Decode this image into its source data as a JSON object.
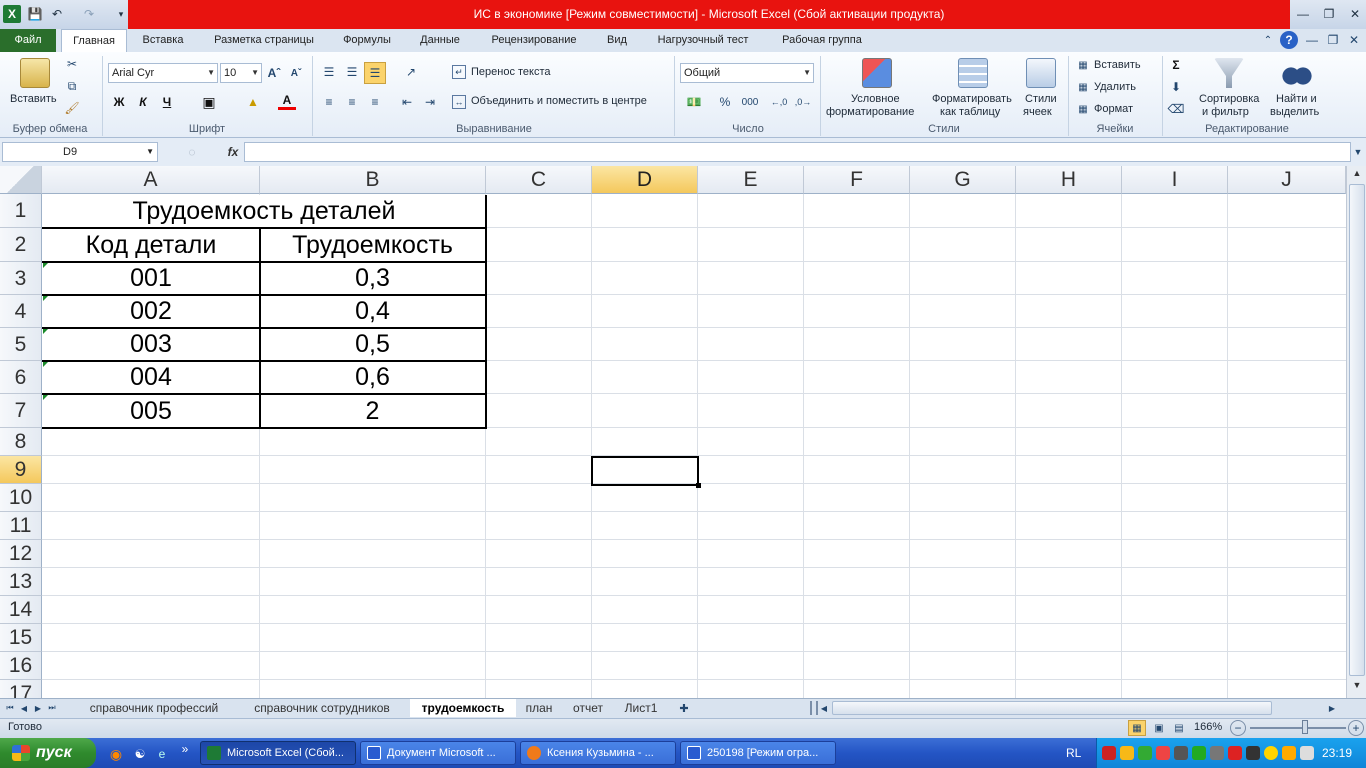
{
  "window": {
    "title": "ИС в экономике  [Режим совместимости]  -  Microsoft Excel (Сбой активации продукта)"
  },
  "ribbon_tabs": [
    "Файл",
    "Главная",
    "Вставка",
    "Разметка страницы",
    "Формулы",
    "Данные",
    "Рецензирование",
    "Вид",
    "Нагрузочный тест",
    "Рабочая группа"
  ],
  "ribbon": {
    "clipboard": {
      "paste": "Вставить",
      "group": "Буфер обмена"
    },
    "font": {
      "name": "Arial Cyr",
      "size": "10",
      "bold": "Ж",
      "italic": "К",
      "underline": "Ч",
      "group": "Шрифт"
    },
    "alignment": {
      "wrap": "Перенос текста",
      "merge": "Объединить и поместить в центре",
      "group": "Выравнивание"
    },
    "number": {
      "format": "Общий",
      "percent": "%",
      "thousands": "000",
      "group": "Число"
    },
    "styles": {
      "conditional1": "Условное",
      "conditional2": "форматирование",
      "astable1": "Форматировать",
      "astable2": "как таблицу",
      "cellstyles1": "Стили",
      "cellstyles2": "ячеек",
      "group": "Стили"
    },
    "cells": {
      "insert": "Вставить",
      "delete": "Удалить",
      "format": "Формат",
      "group": "Ячейки"
    },
    "editing": {
      "sigma": "Σ",
      "sort1": "Сортировка",
      "sort2": "и фильтр",
      "find1": "Найти и",
      "find2": "выделить",
      "group": "Редактирование"
    }
  },
  "formula_bar": {
    "name_box": "D9",
    "fx": "fx",
    "value": ""
  },
  "columns": [
    "A",
    "B",
    "C",
    "D",
    "E",
    "F",
    "G",
    "H",
    "I",
    "J"
  ],
  "rows": [
    "1",
    "2",
    "3",
    "4",
    "5",
    "6",
    "7",
    "8",
    "9",
    "10",
    "11",
    "12",
    "13",
    "14",
    "15",
    "16",
    "17"
  ],
  "sheet": {
    "title": "Трудоемкость деталей",
    "headers": [
      "Код детали",
      "Трудоемкость"
    ],
    "data": [
      [
        "001",
        "0,3"
      ],
      [
        "002",
        "0,4"
      ],
      [
        "003",
        "0,5"
      ],
      [
        "004",
        "0,6"
      ],
      [
        "005",
        "2"
      ]
    ]
  },
  "sheet_tabs": [
    "справочник профессий",
    "справочник сотрудников",
    "трудоемкость",
    "план",
    "отчет",
    "Лист1"
  ],
  "active_sheet": "трудоемкость",
  "status": {
    "ready": "Готово",
    "zoom": "166%"
  },
  "taskbar": {
    "start": "пуск",
    "buttons": [
      "Microsoft Excel (Сбой...",
      "Документ Microsoft ...",
      "Ксения Кузьмина - ...",
      "250198 [Режим огра..."
    ],
    "lang": "RL",
    "clock": "23:19"
  },
  "colors": {
    "title_red": "#e8130f",
    "file_tab": "#2a6e2b",
    "selected_header": "#f4c85c"
  }
}
